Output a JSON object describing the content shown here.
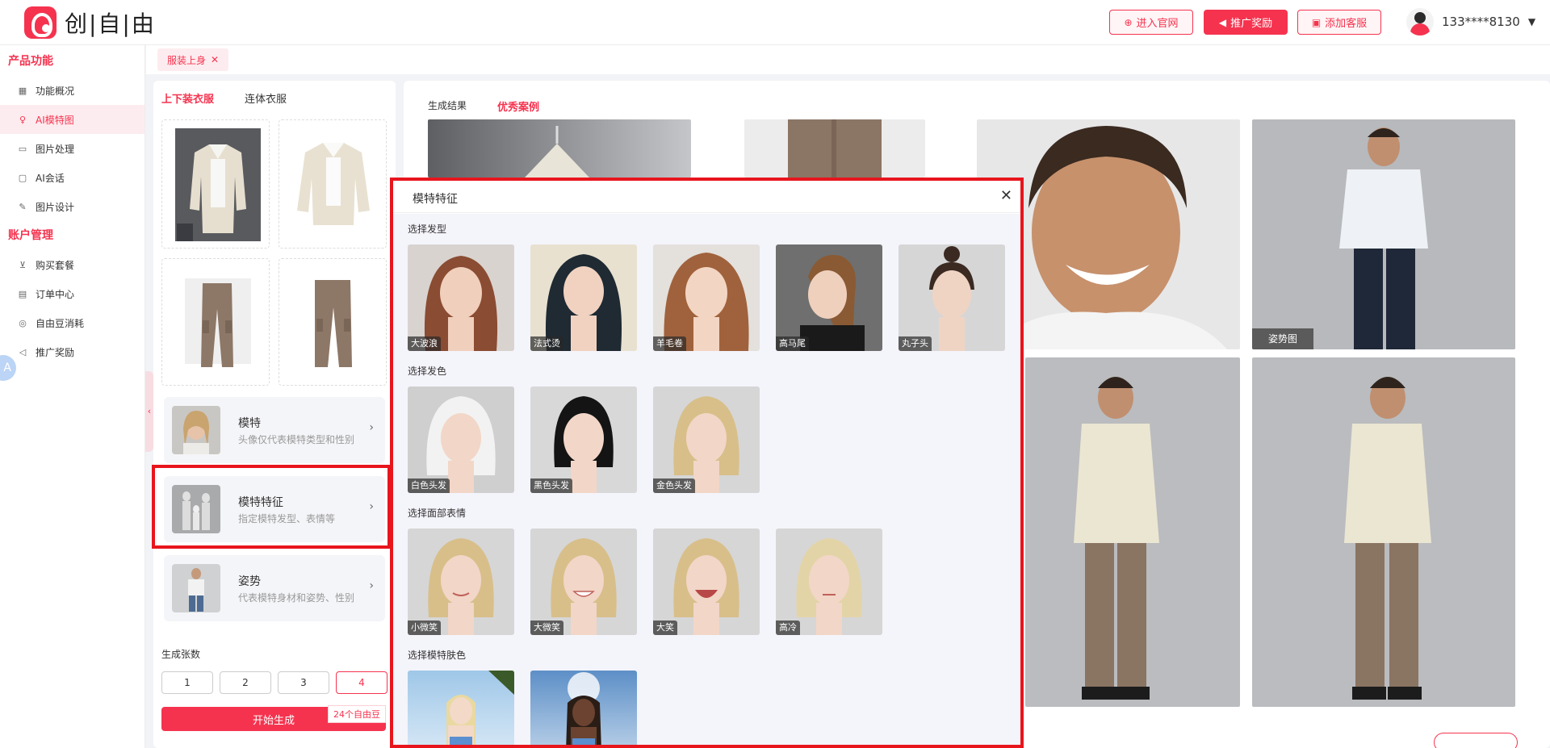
{
  "app": {
    "logo_text": "创|自|由"
  },
  "header": {
    "buttons": [
      {
        "label": "进入官网",
        "icon": "globe-icon"
      },
      {
        "label": "推广奖励",
        "icon": "megaphone-icon"
      },
      {
        "label": "添加客服",
        "icon": "gift-icon"
      }
    ],
    "user": {
      "name": "133****8130"
    }
  },
  "sidebar": {
    "sections": [
      {
        "title": "产品功能",
        "items": [
          {
            "label": "功能概况",
            "icon": "grid-icon"
          },
          {
            "label": "AI模特图",
            "icon": "model-icon",
            "active": true
          },
          {
            "label": "图片处理",
            "icon": "image-icon"
          },
          {
            "label": "AI会话",
            "icon": "chat-icon"
          },
          {
            "label": "图片设计",
            "icon": "design-icon"
          }
        ]
      },
      {
        "title": "账户管理",
        "items": [
          {
            "label": "购买套餐",
            "icon": "cart-icon"
          },
          {
            "label": "订单中心",
            "icon": "order-icon"
          },
          {
            "label": "自由豆消耗",
            "icon": "coin-icon"
          },
          {
            "label": "推广奖励",
            "icon": "megaphone-icon"
          }
        ]
      }
    ],
    "float_badge": "A"
  },
  "tabstrip": {
    "tab": "服装上身"
  },
  "left_panel": {
    "tabs": [
      "上下装衣服",
      "连体衣服"
    ],
    "options": [
      {
        "title": "模特",
        "desc": "头像仅代表模特类型和性别"
      },
      {
        "title": "模特特征",
        "desc": "指定模特发型、表情等"
      },
      {
        "title": "姿势",
        "desc": "代表模特身材和姿势、性别"
      }
    ],
    "count_label": "生成张数",
    "counts": [
      "1",
      "2",
      "3",
      "4"
    ],
    "selected_count": "4",
    "generate_label": "开始生成",
    "cost_tag": "24个自由豆"
  },
  "result_panel": {
    "tabs": [
      "生成结果",
      "优秀案例"
    ],
    "photo_tags": [
      "图",
      "姿势图"
    ]
  },
  "modal": {
    "title": "模特特征",
    "sections": [
      {
        "title": "选择发型",
        "items": [
          "大波浪",
          "法式烫",
          "羊毛卷",
          "高马尾",
          "丸子头"
        ]
      },
      {
        "title": "选择发色",
        "items": [
          "白色头发",
          "黑色头发",
          "金色头发"
        ]
      },
      {
        "title": "选择面部表情",
        "items": [
          "小微笑",
          "大微笑",
          "大笑",
          "高冷"
        ]
      },
      {
        "title": "选择模特肤色",
        "items": []
      }
    ]
  },
  "colors": {
    "accent": "#f5334f",
    "highlight": "#e8151d"
  }
}
